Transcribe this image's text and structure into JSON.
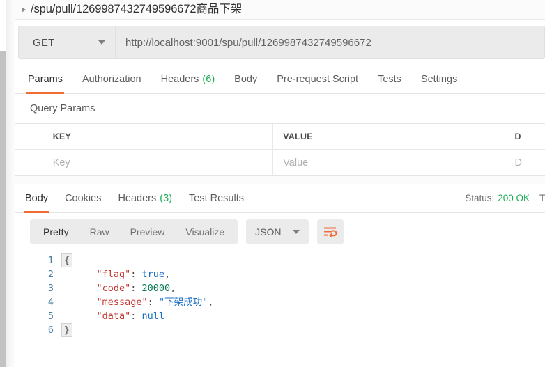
{
  "window": {
    "title": "/spu/pull/1269987432749596672商品下架",
    "caret_icon": "triangle-right-icon"
  },
  "request": {
    "method": "GET",
    "method_dropdown_icon": "chevron-down-icon",
    "url": "http://localhost:9001/spu/pull/1269987432749596672",
    "tabs": [
      {
        "label": "Params",
        "badge": "",
        "active": true
      },
      {
        "label": "Authorization",
        "badge": "",
        "active": false
      },
      {
        "label": "Headers",
        "badge": "(6)",
        "active": false
      },
      {
        "label": "Body",
        "badge": "",
        "active": false
      },
      {
        "label": "Pre-request Script",
        "badge": "",
        "active": false
      },
      {
        "label": "Tests",
        "badge": "",
        "active": false
      },
      {
        "label": "Settings",
        "badge": "",
        "active": false
      }
    ]
  },
  "query_params": {
    "section_label": "Query Params",
    "headers": {
      "key": "KEY",
      "value": "VALUE",
      "description": "D"
    },
    "row": {
      "key_placeholder": "Key",
      "value_placeholder": "Value",
      "desc_placeholder": "D"
    }
  },
  "response": {
    "tabs": [
      {
        "label": "Body",
        "badge": "",
        "active": true
      },
      {
        "label": "Cookies",
        "badge": "",
        "active": false
      },
      {
        "label": "Headers",
        "badge": "(3)",
        "active": false
      },
      {
        "label": "Test Results",
        "badge": "",
        "active": false
      }
    ],
    "status_label": "Status:",
    "status_value": "200 OK",
    "time_label_clipped": "T",
    "view_modes": [
      {
        "label": "Pretty",
        "active": true
      },
      {
        "label": "Raw",
        "active": false
      },
      {
        "label": "Preview",
        "active": false
      },
      {
        "label": "Visualize",
        "active": false
      }
    ],
    "format": "JSON",
    "format_dropdown_icon": "chevron-down-icon",
    "wrap_icon": "word-wrap-icon",
    "body_lines": [
      {
        "n": "1",
        "fold": "brace-open",
        "tokens": [
          {
            "t": "{",
            "c": "tk-punc"
          }
        ]
      },
      {
        "n": "2",
        "fold": "bar",
        "tokens": [
          {
            "t": "    \"flag\"",
            "c": "tk-key"
          },
          {
            "t": ": ",
            "c": "tk-punc"
          },
          {
            "t": "true",
            "c": "tk-bool"
          },
          {
            "t": ",",
            "c": "tk-punc"
          }
        ]
      },
      {
        "n": "3",
        "fold": "bar",
        "tokens": [
          {
            "t": "    \"code\"",
            "c": "tk-key"
          },
          {
            "t": ": ",
            "c": "tk-punc"
          },
          {
            "t": "20000",
            "c": "tk-num"
          },
          {
            "t": ",",
            "c": "tk-punc"
          }
        ]
      },
      {
        "n": "4",
        "fold": "bar",
        "tokens": [
          {
            "t": "    \"message\"",
            "c": "tk-key"
          },
          {
            "t": ": ",
            "c": "tk-punc"
          },
          {
            "t": "\"下架成功\"",
            "c": "tk-str"
          },
          {
            "t": ",",
            "c": "tk-punc"
          }
        ]
      },
      {
        "n": "5",
        "fold": "bar",
        "tokens": [
          {
            "t": "    \"data\"",
            "c": "tk-key"
          },
          {
            "t": ": ",
            "c": "tk-punc"
          },
          {
            "t": "null",
            "c": "tk-null"
          }
        ]
      },
      {
        "n": "6",
        "fold": "brace-close",
        "tokens": [
          {
            "t": "}",
            "c": "tk-punc"
          }
        ]
      }
    ]
  },
  "colors": {
    "accent": "#ef6c35",
    "success": "#1bab56",
    "toolbar_bg": "#ebebeb"
  }
}
